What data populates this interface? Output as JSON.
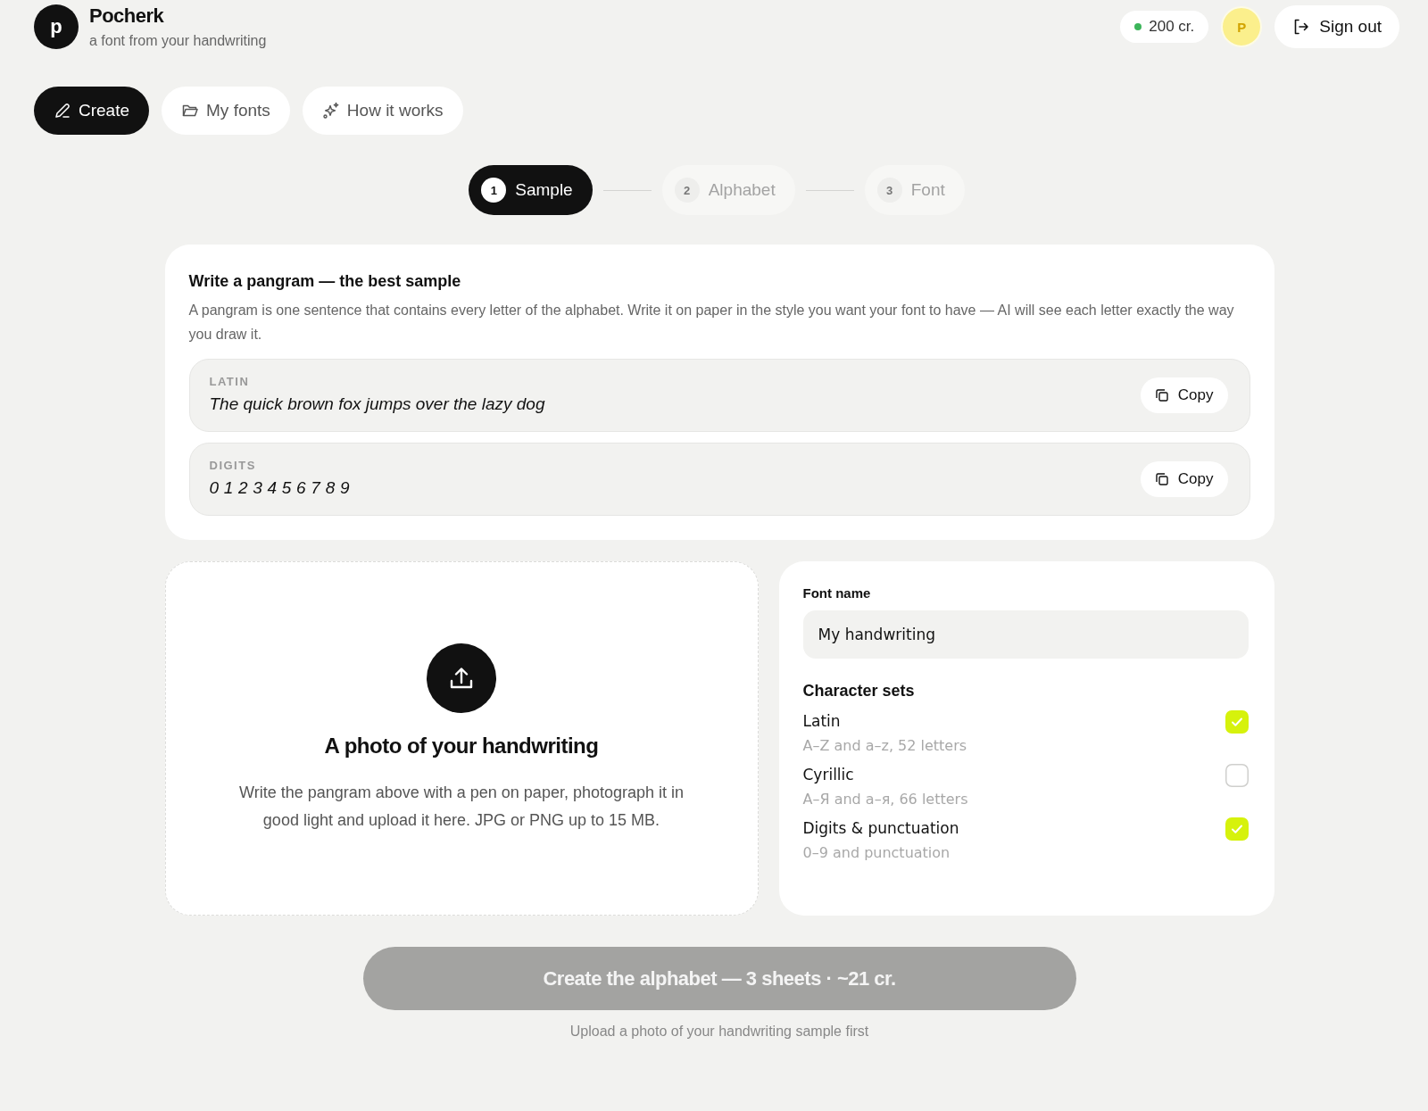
{
  "brand": {
    "logo_letter": "p",
    "name": "Pocherk",
    "tagline": "a font from your handwriting"
  },
  "account": {
    "credits": "200 cr.",
    "avatar_letter": "P",
    "sign_out": "Sign out"
  },
  "nav": [
    {
      "label": "Create",
      "selected": true
    },
    {
      "label": "My fonts",
      "selected": false
    },
    {
      "label": "How it works",
      "selected": false
    }
  ],
  "steps": [
    {
      "number": "1",
      "label": "Sample",
      "selected": true
    },
    {
      "number": "2",
      "label": "Alphabet",
      "selected": false
    },
    {
      "number": "3",
      "label": "Font",
      "selected": false
    }
  ],
  "pangram_card": {
    "title": "Write a pangram — the best sample",
    "description": "A pangram is one sentence that contains every letter of the alphabet. Write it on paper in the style you want your font to have — AI will see each letter exactly the way you draw it.",
    "samples": [
      {
        "kind": "sentence",
        "label": "LATIN",
        "text": "The quick brown fox jumps over the lazy dog",
        "copy": "Copy"
      },
      {
        "kind": "digits",
        "label": "DIGITS",
        "text": "0123456789",
        "copy": "Copy"
      }
    ]
  },
  "upload": {
    "title": "A photo of your handwriting",
    "description": "Write the pangram above with a pen on paper, photograph it in good light and upload it here. JPG or PNG up to 15 MB."
  },
  "settings": {
    "font_name_label": "Font name",
    "font_name_value": "My handwriting",
    "character_sets_title": "Character sets",
    "character_sets": [
      {
        "name": "Latin",
        "detail": "A–Z and a–z, 52 letters",
        "checked": true
      },
      {
        "name": "Cyrillic",
        "detail": "А–Я and а–я, 66 letters",
        "checked": false
      },
      {
        "name": "Digits & punctuation",
        "detail": "0–9 and punctuation",
        "checked": true
      }
    ]
  },
  "create_button": {
    "label": "Create the alphabet — 3 sheets · ~21 cr.",
    "disabled": true
  },
  "hint": "Upload a photo of your handwriting sample first"
}
